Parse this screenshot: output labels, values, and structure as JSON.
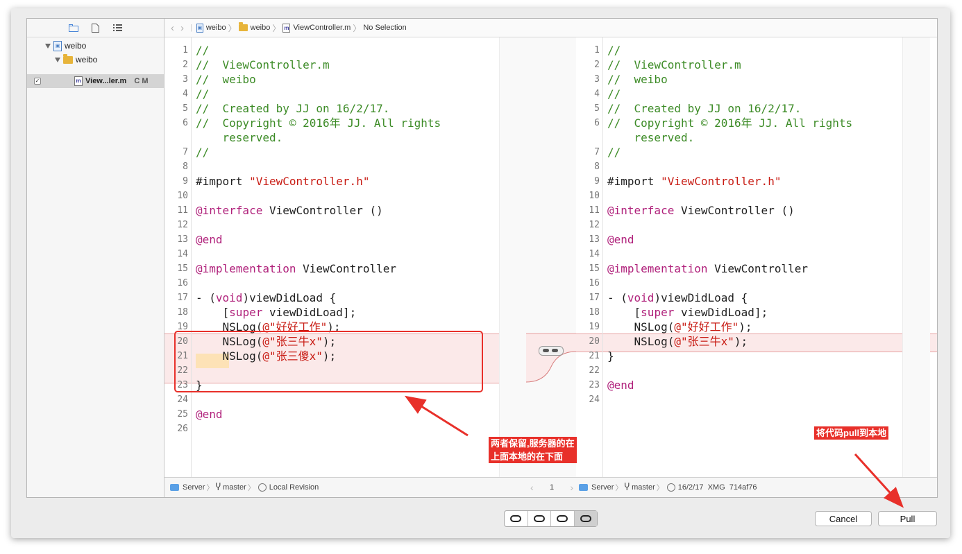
{
  "navigator": {
    "items": [
      {
        "label": "weibo"
      },
      {
        "label": "weibo"
      },
      {
        "label": "View...ler.m",
        "badge": "C M"
      }
    ]
  },
  "jumpbar": {
    "crumbs": [
      "weibo",
      "weibo",
      "ViewController.m",
      "No Selection"
    ]
  },
  "left_editor": {
    "lines": [
      {
        "n": "1",
        "segs": [
          {
            "t": "//",
            "c": "cmt"
          }
        ]
      },
      {
        "n": "2",
        "segs": [
          {
            "t": "//  ViewController.m",
            "c": "cmt"
          }
        ]
      },
      {
        "n": "3",
        "segs": [
          {
            "t": "//  weibo",
            "c": "cmt"
          }
        ]
      },
      {
        "n": "4",
        "segs": [
          {
            "t": "//",
            "c": "cmt"
          }
        ]
      },
      {
        "n": "5",
        "segs": [
          {
            "t": "//  Created by JJ on 16/2/17.",
            "c": "cmt"
          }
        ]
      },
      {
        "n": "6",
        "segs": [
          {
            "t": "//  Copyright © 2016年 JJ. All rights",
            "c": "cmt"
          }
        ]
      },
      {
        "n": "",
        "segs": [
          {
            "t": "    reserved.",
            "c": "cmt"
          }
        ]
      },
      {
        "n": "7",
        "segs": [
          {
            "t": "//",
            "c": "cmt"
          }
        ]
      },
      {
        "n": "8",
        "segs": []
      },
      {
        "n": "9",
        "segs": [
          {
            "t": "#import ",
            "c": "plain"
          },
          {
            "t": "\"ViewController.h\"",
            "c": "str"
          }
        ]
      },
      {
        "n": "10",
        "segs": []
      },
      {
        "n": "11",
        "segs": [
          {
            "t": "@interface",
            "c": "kw"
          },
          {
            "t": " ViewController ()",
            "c": "plain"
          }
        ]
      },
      {
        "n": "12",
        "segs": []
      },
      {
        "n": "13",
        "segs": [
          {
            "t": "@end",
            "c": "kw"
          }
        ]
      },
      {
        "n": "14",
        "segs": []
      },
      {
        "n": "15",
        "segs": [
          {
            "t": "@implementation",
            "c": "kw"
          },
          {
            "t": " ViewController",
            "c": "plain"
          }
        ]
      },
      {
        "n": "16",
        "segs": []
      },
      {
        "n": "17",
        "segs": [
          {
            "t": "- (",
            "c": "plain"
          },
          {
            "t": "void",
            "c": "kw"
          },
          {
            "t": ")viewDidLoad {",
            "c": "plain"
          }
        ]
      },
      {
        "n": "18",
        "segs": [
          {
            "t": "    [",
            "c": "plain"
          },
          {
            "t": "super",
            "c": "kw"
          },
          {
            "t": " viewDidLoad];",
            "c": "plain"
          }
        ]
      },
      {
        "n": "19",
        "segs": [
          {
            "t": "    NSLog(",
            "c": "plain"
          },
          {
            "t": "@\"好好工作\"",
            "c": "str"
          },
          {
            "t": ");",
            "c": "plain"
          }
        ]
      },
      {
        "n": "20",
        "segs": [
          {
            "t": "    NSLog(",
            "c": "plain"
          },
          {
            "t": "@\"张三牛x\"",
            "c": "str"
          },
          {
            "t": ");",
            "c": "plain"
          }
        ]
      },
      {
        "n": "21",
        "segs": [
          {
            "t": "    NSLog(",
            "c": "plain"
          },
          {
            "t": "@\"张三傻x\"",
            "c": "str"
          },
          {
            "t": ");",
            "c": "plain"
          }
        ]
      },
      {
        "n": "22",
        "segs": []
      },
      {
        "n": "23",
        "segs": [
          {
            "t": "}",
            "c": "plain"
          }
        ]
      },
      {
        "n": "24",
        "segs": []
      },
      {
        "n": "25",
        "segs": [
          {
            "t": "@end",
            "c": "kw"
          }
        ]
      },
      {
        "n": "26",
        "segs": []
      }
    ]
  },
  "right_editor": {
    "lines": [
      {
        "n": "1",
        "segs": [
          {
            "t": "//",
            "c": "cmt"
          }
        ]
      },
      {
        "n": "2",
        "segs": [
          {
            "t": "//  ViewController.m",
            "c": "cmt"
          }
        ]
      },
      {
        "n": "3",
        "segs": [
          {
            "t": "//  weibo",
            "c": "cmt"
          }
        ]
      },
      {
        "n": "4",
        "segs": [
          {
            "t": "//",
            "c": "cmt"
          }
        ]
      },
      {
        "n": "5",
        "segs": [
          {
            "t": "//  Created by JJ on 16/2/17.",
            "c": "cmt"
          }
        ]
      },
      {
        "n": "6",
        "segs": [
          {
            "t": "//  Copyright © 2016年 JJ. All rights",
            "c": "cmt"
          }
        ]
      },
      {
        "n": "",
        "segs": [
          {
            "t": "    reserved.",
            "c": "cmt"
          }
        ]
      },
      {
        "n": "7",
        "segs": [
          {
            "t": "//",
            "c": "cmt"
          }
        ]
      },
      {
        "n": "8",
        "segs": []
      },
      {
        "n": "9",
        "segs": [
          {
            "t": "#import ",
            "c": "plain"
          },
          {
            "t": "\"ViewController.h\"",
            "c": "str"
          }
        ]
      },
      {
        "n": "10",
        "segs": []
      },
      {
        "n": "11",
        "segs": [
          {
            "t": "@interface",
            "c": "kw"
          },
          {
            "t": " ViewController ()",
            "c": "plain"
          }
        ]
      },
      {
        "n": "12",
        "segs": []
      },
      {
        "n": "13",
        "segs": [
          {
            "t": "@end",
            "c": "kw"
          }
        ]
      },
      {
        "n": "14",
        "segs": []
      },
      {
        "n": "15",
        "segs": [
          {
            "t": "@implementation",
            "c": "kw"
          },
          {
            "t": " ViewController",
            "c": "plain"
          }
        ]
      },
      {
        "n": "16",
        "segs": []
      },
      {
        "n": "17",
        "segs": [
          {
            "t": "- (",
            "c": "plain"
          },
          {
            "t": "void",
            "c": "kw"
          },
          {
            "t": ")viewDidLoad {",
            "c": "plain"
          }
        ]
      },
      {
        "n": "18",
        "segs": [
          {
            "t": "    [",
            "c": "plain"
          },
          {
            "t": "super",
            "c": "kw"
          },
          {
            "t": " viewDidLoad];",
            "c": "plain"
          }
        ]
      },
      {
        "n": "19",
        "segs": [
          {
            "t": "    NSLog(",
            "c": "plain"
          },
          {
            "t": "@\"好好工作\"",
            "c": "str"
          },
          {
            "t": ");",
            "c": "plain"
          }
        ]
      },
      {
        "n": "20",
        "segs": [
          {
            "t": "    NSLog(",
            "c": "plain"
          },
          {
            "t": "@\"张三牛x\"",
            "c": "str"
          },
          {
            "t": ");",
            "c": "plain"
          }
        ]
      },
      {
        "n": "21",
        "segs": [
          {
            "t": "}",
            "c": "plain"
          }
        ]
      },
      {
        "n": "22",
        "segs": []
      },
      {
        "n": "23",
        "segs": [
          {
            "t": "@end",
            "c": "kw"
          }
        ]
      },
      {
        "n": "24",
        "segs": []
      }
    ]
  },
  "left_status": {
    "server": "Server",
    "branch": "master",
    "revision": "Local Revision"
  },
  "change_counter": "1",
  "right_status": {
    "server": "Server",
    "branch": "master",
    "revision": "16/2/17  XMG  714af76"
  },
  "annotations": {
    "note1_line1": "两者保留,服务器的在",
    "note1_line2": "上面本地的在下面",
    "note2": "将代码pull到本地"
  },
  "buttons": {
    "cancel": "Cancel",
    "pull": "Pull"
  },
  "colors": {
    "comment": "#3c8b26",
    "keyword": "#b0217b",
    "string": "#c81b13",
    "diff_bg": "#fbe9e9",
    "annotation": "#e8302a"
  }
}
